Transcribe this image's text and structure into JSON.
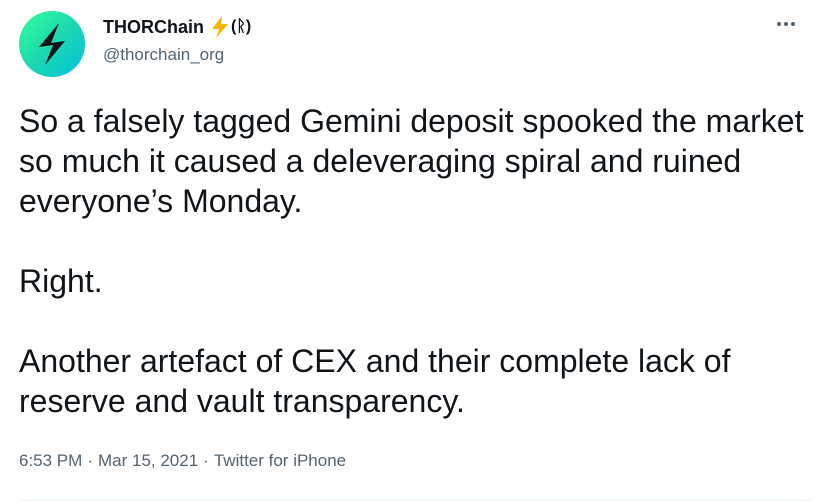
{
  "author": {
    "display_name": "THORChain",
    "handle": "@thorchain_org",
    "badge_emoji": "high-voltage-icon",
    "badge_text": "(ᚱ)"
  },
  "more_menu_icon": "more-horizontal-icon",
  "tweet": {
    "paragraphs": [
      "So a falsely tagged Gemini deposit spooked the market so much it caused a deleveraging spiral and ruined everyone’s Monday.",
      "Right.",
      "Another artefact of CEX and their complete lack of reserve and vault transparency."
    ]
  },
  "meta": {
    "time": "6:53 PM",
    "separator": "·",
    "date": "Mar 15, 2021",
    "source": "Twitter for iPhone"
  },
  "colors": {
    "text_primary": "#0f1419",
    "text_secondary": "#536471",
    "avatar_gradient_start": "#33ff99",
    "avatar_gradient_end": "#00c2e0"
  }
}
